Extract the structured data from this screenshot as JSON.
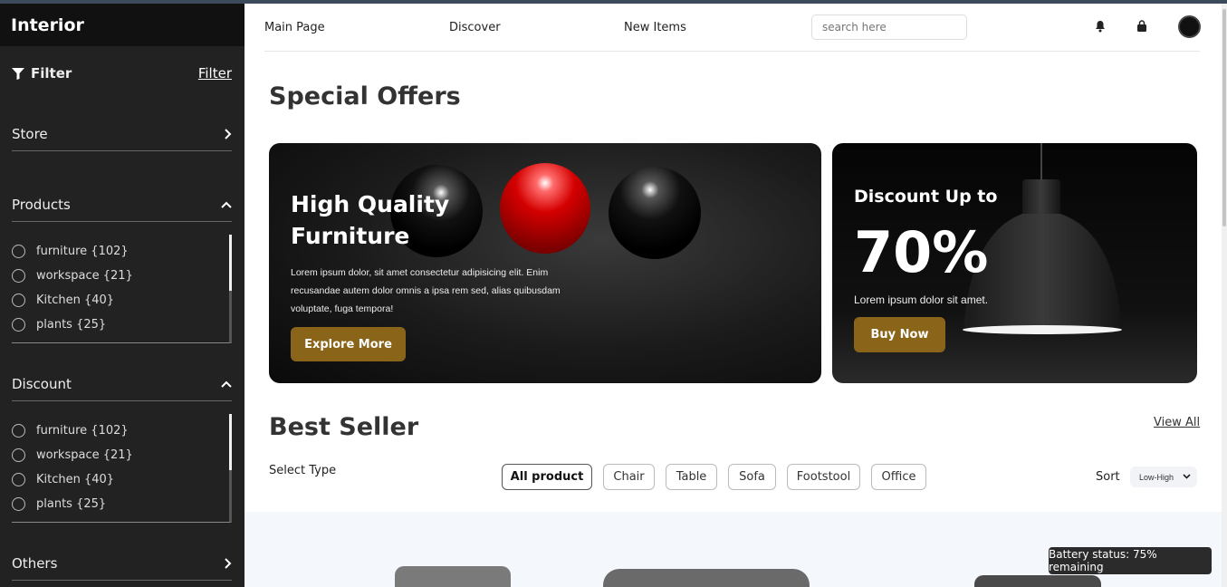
{
  "brand": "Interior",
  "sidebar": {
    "filter_title": "Filter",
    "filter_link": "Filter",
    "sections": [
      {
        "label": "Store",
        "expanded": false,
        "icon": "chevron-right-icon"
      },
      {
        "label": "Products",
        "expanded": true,
        "icon": "chevron-up-icon",
        "options": [
          "furniture {102}",
          "workspace {21}",
          "Kitchen {40}",
          "plants {25}"
        ]
      },
      {
        "label": "Discount",
        "expanded": true,
        "icon": "chevron-up-icon",
        "options": [
          "furniture {102}",
          "workspace {21}",
          "Kitchen {40}",
          "plants {25}"
        ]
      },
      {
        "label": "Others",
        "expanded": false,
        "icon": "chevron-right-icon"
      }
    ]
  },
  "nav": {
    "links": [
      "Main Page",
      "Discover",
      "New Items"
    ],
    "search_placeholder": "search here",
    "icons": [
      "bell-icon",
      "shopping-bag-icon",
      "avatar"
    ]
  },
  "special": {
    "heading": "Special Offers",
    "card1": {
      "title_line1": "High Quality",
      "title_line2": "Furniture",
      "text": "Lorem ipsum dolor, sit amet consectetur adipisicing elit. Enim recusandae autem dolor omnis a ipsa rem sed, alias quibusdam voluptate, fuga tempora!",
      "button": "Explore More"
    },
    "card2": {
      "title": "Discount Up to",
      "big": "70%",
      "text": "Lorem ipsum dolor sit amet.",
      "button": "Buy Now"
    }
  },
  "best": {
    "heading": "Best Seller",
    "view_all": "View All",
    "select_type": "Select Type",
    "pills": [
      "All product",
      "Chair",
      "Table",
      "Sofa",
      "Footstool",
      "Office"
    ],
    "active_pill": "All product",
    "sort_label": "Sort",
    "sort_value": "Low-High"
  },
  "toast": "Battery status: 75% remaining",
  "colors": {
    "accent": "#8a6418",
    "sidebar": "#222222"
  }
}
